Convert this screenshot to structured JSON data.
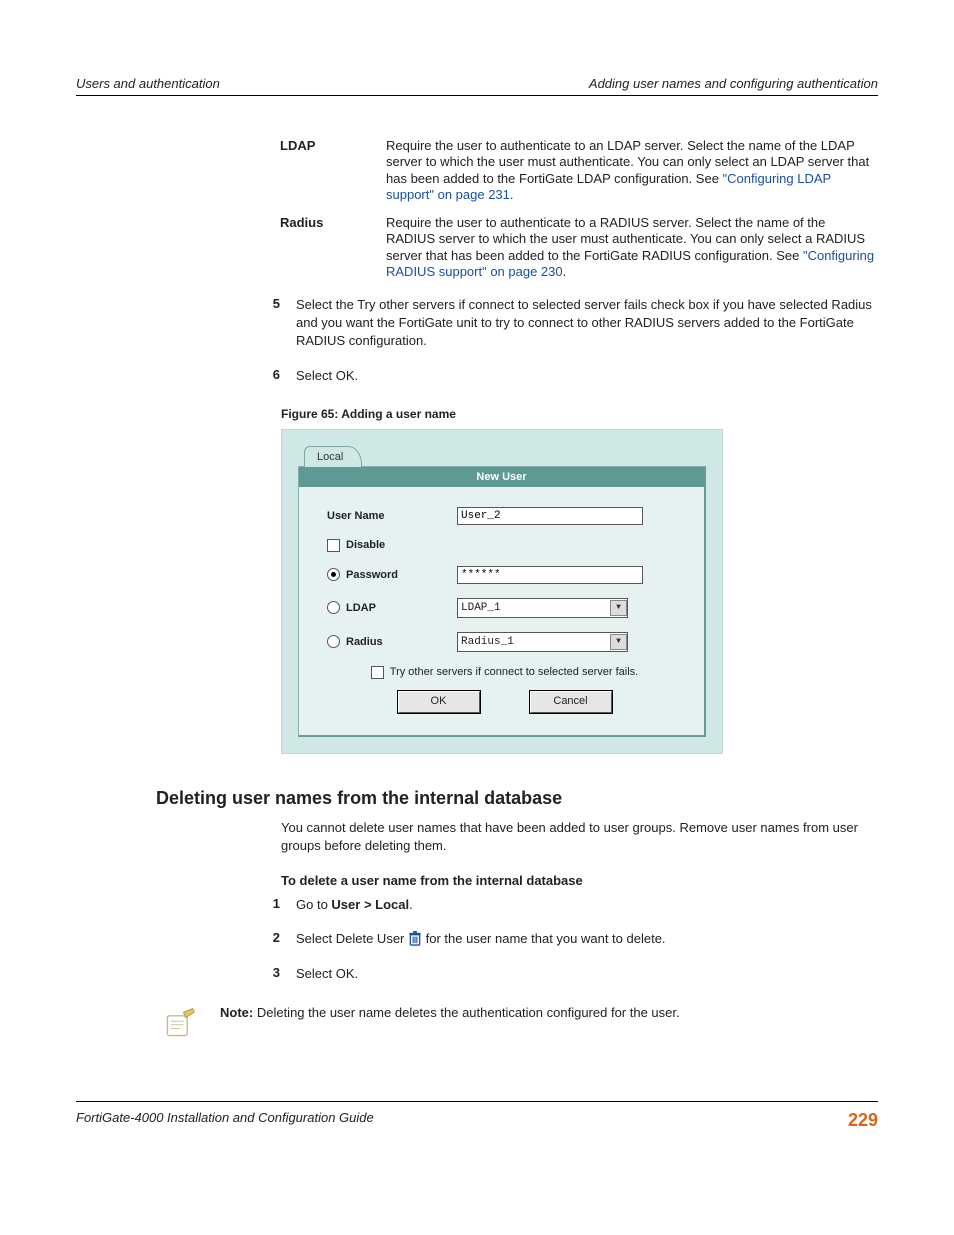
{
  "header": {
    "left": "Users and authentication",
    "right": "Adding user names and configuring authentication"
  },
  "defs": {
    "ldap": {
      "term": "LDAP",
      "desc_a": "Require the user to authenticate to an LDAP server. Select the name of the LDAP server to which the user must authenticate. You can only select an LDAP server that has been added to the FortiGate LDAP configuration. See ",
      "link": "\"Configuring LDAP support\" on page 231",
      "desc_b": "."
    },
    "radius": {
      "term": "Radius",
      "desc_a": "Require the user to authenticate to a RADIUS server. Select the name of the RADIUS server to which the user must authenticate. You can only select a RADIUS server that has been added to the FortiGate RADIUS configuration. See ",
      "link": "\"Configuring RADIUS support\" on page 230",
      "desc_b": "."
    }
  },
  "steps_a": {
    "s5": {
      "n": "5",
      "t": "Select the Try other servers if connect to selected server fails check box if you have selected Radius and you want the FortiGate unit to try to connect to other RADIUS servers added to the FortiGate RADIUS configuration."
    },
    "s6": {
      "n": "6",
      "t": "Select OK."
    }
  },
  "figure": {
    "caption": "Figure 65: Adding a user name",
    "tab": "Local",
    "panel_title": "New User",
    "labels": {
      "username": "User Name",
      "disable": "Disable",
      "password": "Password",
      "ldap": "LDAP",
      "radius": "Radius",
      "tryother": "Try other servers if connect to selected server fails."
    },
    "values": {
      "username": "User_2",
      "password": "******",
      "ldap": "LDAP_1",
      "radius": "Radius_1"
    },
    "buttons": {
      "ok": "OK",
      "cancel": "Cancel"
    }
  },
  "section2": {
    "title": "Deleting user names from the internal database",
    "intro": "You cannot delete user names that have been added to user groups. Remove user names from user groups before deleting them.",
    "subhead": "To delete a user name from the internal database",
    "steps": {
      "s1": {
        "n": "1",
        "pre": "Go to ",
        "bold": "User > Local",
        "post": "."
      },
      "s2": {
        "n": "2",
        "pre": "Select Delete User ",
        "post": " for the user name that you want to delete."
      },
      "s3": {
        "n": "3",
        "t": "Select OK."
      }
    },
    "note_label": "Note:",
    "note": " Deleting the user name deletes the authentication configured for the user."
  },
  "footer": {
    "left": "FortiGate-4000 Installation and Configuration Guide",
    "page": "229"
  }
}
